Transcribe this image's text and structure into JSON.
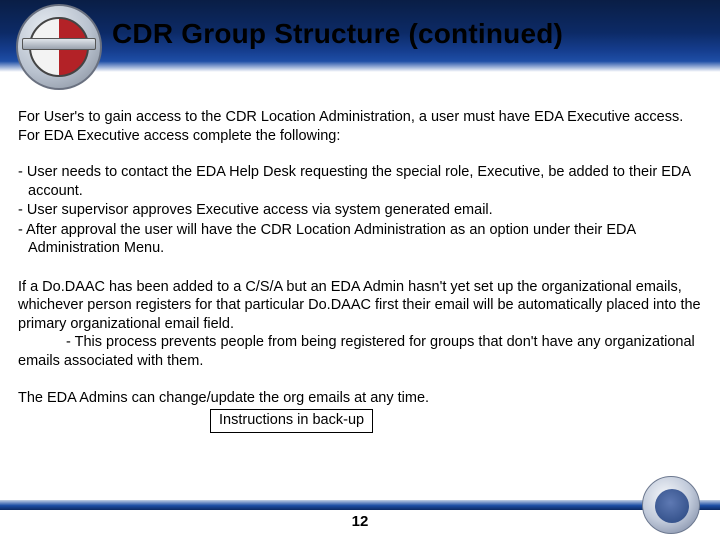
{
  "title": "CDR Group Structure (continued)",
  "intro": "For User's to gain access to the CDR Location Administration, a user must have EDA Executive access.  For EDA Executive access complete the following:",
  "bullets": [
    "-  User needs to contact the EDA Help Desk requesting the special role, Executive, be added to their EDA account.",
    "-  User supervisor approves Executive access via system generated email.",
    "-  After approval the user will have the CDR Location Administration as an option under their EDA Administration Menu."
  ],
  "para2_line1": "If a Do.DAAC has been added to a C/S/A but an EDA Admin hasn't yet set up the organizational emails, whichever person registers for that particular Do.DAAC first their email will be automatically placed into the primary organizational email field.",
  "para2_line2": "- This process prevents people from being registered for groups that don't have any organizational emails associated with them.",
  "para3": "The EDA Admins can change/update the org emails at any time.",
  "box_label": "Instructions in back-up",
  "page_number": "12"
}
